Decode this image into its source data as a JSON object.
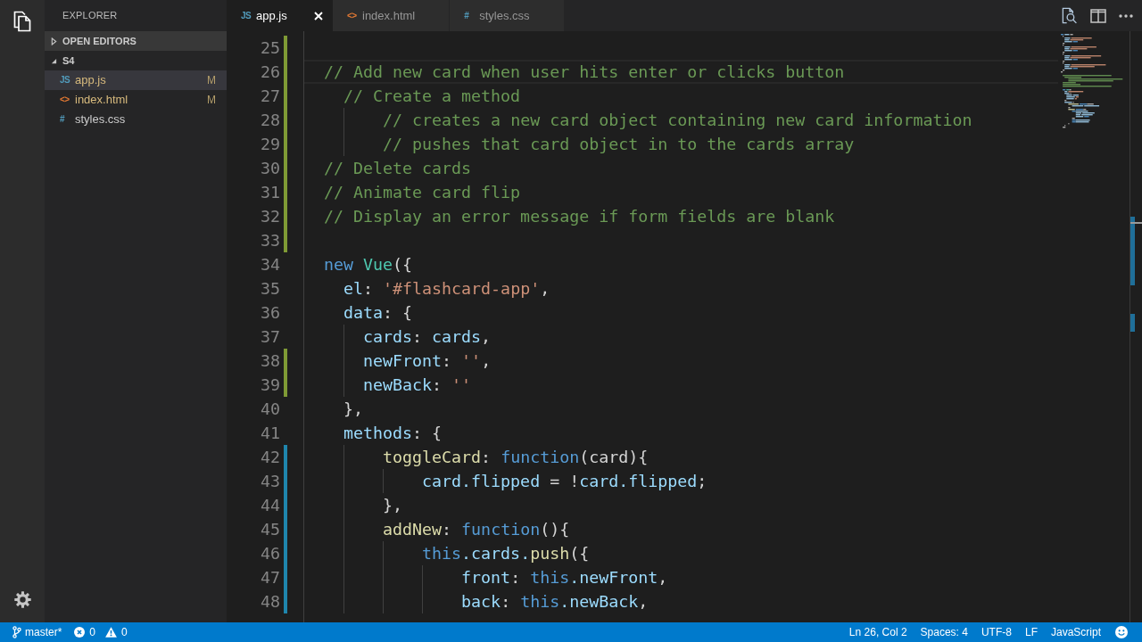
{
  "activity_bar": {
    "items": [
      {
        "kind": "files",
        "selected": true
      }
    ]
  },
  "sidebar": {
    "title": "EXPLORER",
    "sections": [
      {
        "title": "OPEN EDITORS",
        "expanded": false,
        "highlighted": true
      },
      {
        "title": "S4",
        "expanded": true,
        "highlighted": false,
        "files": [
          {
            "name": "app.js",
            "icon": "JS",
            "color": "#519aba",
            "status": "M",
            "selected": true
          },
          {
            "name": "index.html",
            "icon": "<>",
            "color": "#e37933",
            "status": "M",
            "selected": false
          },
          {
            "name": "styles.css",
            "icon": "#",
            "color": "#519aba",
            "selected": false
          }
        ]
      }
    ]
  },
  "tabs": [
    {
      "label": "app.js",
      "icon": "JS",
      "color": "#519aba",
      "selected": true
    },
    {
      "label": "index.html",
      "icon": "<>",
      "color": "#e37933",
      "selected": false
    },
    {
      "label": "styles.css",
      "icon": "#",
      "color": "#519aba",
      "selected": false
    }
  ],
  "editor": {
    "lines": [
      {
        "number": "25",
        "added": true
      },
      {
        "number": "26",
        "added": true,
        "current": true,
        "tokens": [
          {
            "kind": "comment",
            "text": "  // Add new card when user hits enter or clicks button"
          }
        ]
      },
      {
        "number": "27",
        "added": true,
        "tokens": [
          {
            "kind": "comment",
            "text": "    // Create a method"
          }
        ]
      },
      {
        "number": "28",
        "added": true,
        "tokens": [
          {
            "kind": "comment",
            "text": "        // creates a new card object containing new card information"
          }
        ]
      },
      {
        "number": "29",
        "added": true,
        "tokens": [
          {
            "kind": "comment",
            "text": "        // pushes that card object in to the cards array"
          }
        ]
      },
      {
        "number": "30",
        "added": true,
        "tokens": [
          {
            "kind": "comment",
            "text": "  // Delete cards"
          }
        ]
      },
      {
        "number": "31",
        "added": true,
        "tokens": [
          {
            "kind": "comment",
            "text": "  // Animate card flip"
          }
        ]
      },
      {
        "number": "32",
        "added": true,
        "tokens": [
          {
            "kind": "comment",
            "text": "  // Display an error message if form fields are blank"
          }
        ]
      },
      {
        "number": "33",
        "added": true
      },
      {
        "number": "34",
        "tokens": [
          {
            "kind": "keyword",
            "text": "  new"
          },
          {
            "kind": "class",
            "text": " Vue"
          },
          {
            "kind": "punct",
            "text": "({"
          }
        ]
      },
      {
        "number": "35",
        "tokens": [
          {
            "kind": "property",
            "text": "    el"
          },
          {
            "kind": "punct",
            "text": ": "
          },
          {
            "kind": "string",
            "text": "'#flashcard-app'"
          },
          {
            "kind": "punct",
            "text": ","
          }
        ]
      },
      {
        "number": "36",
        "tokens": [
          {
            "kind": "property",
            "text": "    data"
          },
          {
            "kind": "punct",
            "text": ": {"
          }
        ]
      },
      {
        "number": "37",
        "tokens": [
          {
            "kind": "property",
            "text": "      cards"
          },
          {
            "kind": "punct",
            "text": ": "
          },
          {
            "kind": "variable",
            "text": "cards"
          },
          {
            "kind": "punct",
            "text": ","
          }
        ]
      },
      {
        "number": "38",
        "added": true,
        "tokens": [
          {
            "kind": "property",
            "text": "      newFront"
          },
          {
            "kind": "punct",
            "text": ": "
          },
          {
            "kind": "string",
            "text": "''"
          },
          {
            "kind": "punct",
            "text": ","
          }
        ]
      },
      {
        "number": "39",
        "added": true,
        "tokens": [
          {
            "kind": "property",
            "text": "      newBack"
          },
          {
            "kind": "punct",
            "text": ": "
          },
          {
            "kind": "string",
            "text": "''"
          }
        ]
      },
      {
        "number": "40",
        "tokens": [
          {
            "kind": "punct",
            "text": "    },"
          }
        ]
      },
      {
        "number": "41",
        "tokens": [
          {
            "kind": "property",
            "text": "    methods"
          },
          {
            "kind": "punct",
            "text": ": {"
          }
        ]
      },
      {
        "number": "42",
        "modified": true,
        "tokens": [
          {
            "kind": "function",
            "text": "        toggleCard"
          },
          {
            "kind": "punct",
            "text": ": "
          },
          {
            "kind": "keyword",
            "text": "function"
          },
          {
            "kind": "punct",
            "text": "(card){"
          }
        ]
      },
      {
        "number": "43",
        "modified": true,
        "tokens": [
          {
            "kind": "variable",
            "text": "            card.flipped"
          },
          {
            "kind": "punct",
            "text": " = !"
          },
          {
            "kind": "variable",
            "text": "card.flipped"
          },
          {
            "kind": "punct",
            "text": ";"
          }
        ]
      },
      {
        "number": "44",
        "modified": true,
        "tokens": [
          {
            "kind": "punct",
            "text": "        },"
          }
        ]
      },
      {
        "number": "45",
        "modified": true,
        "tokens": [
          {
            "kind": "function",
            "text": "        addNew"
          },
          {
            "kind": "punct",
            "text": ": "
          },
          {
            "kind": "keyword",
            "text": "function"
          },
          {
            "kind": "punct",
            "text": "(){"
          }
        ]
      },
      {
        "number": "46",
        "modified": true,
        "tokens": [
          {
            "kind": "keyword",
            "text": "            this"
          },
          {
            "kind": "property",
            "text": ".cards."
          },
          {
            "kind": "function",
            "text": "push"
          },
          {
            "kind": "punct",
            "text": "({"
          }
        ]
      },
      {
        "number": "47",
        "modified": true,
        "tokens": [
          {
            "kind": "property",
            "text": "                front"
          },
          {
            "kind": "punct",
            "text": ": "
          },
          {
            "kind": "keyword",
            "text": "this"
          },
          {
            "kind": "property",
            "text": ".newFront"
          },
          {
            "kind": "punct",
            "text": ","
          }
        ]
      },
      {
        "number": "48",
        "modified": true,
        "tokens": [
          {
            "kind": "property",
            "text": "                back"
          },
          {
            "kind": "punct",
            "text": ": "
          },
          {
            "kind": "keyword",
            "text": "this"
          },
          {
            "kind": "property",
            "text": ".newBack"
          },
          {
            "kind": "punct",
            "text": ","
          }
        ]
      }
    ]
  },
  "status_bar": {
    "branch": "master*",
    "errors": "0",
    "warnings": "0",
    "items": [
      "Ln 26, Col 2",
      "Spaces: 4",
      "UTF-8",
      "LF",
      "JavaScript"
    ]
  }
}
